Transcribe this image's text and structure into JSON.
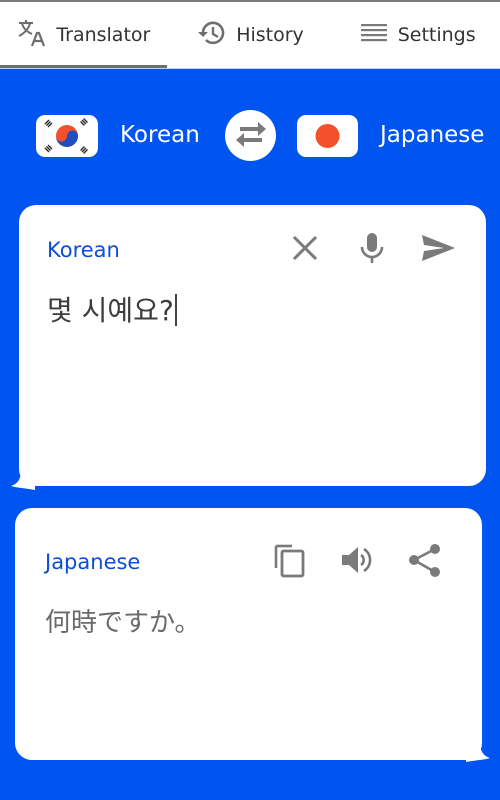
{
  "tabs": [
    {
      "label": "Translator",
      "icon": "translate-icon",
      "active": true
    },
    {
      "label": "History",
      "icon": "history-icon",
      "active": false
    },
    {
      "label": "Settings",
      "icon": "menu-icon",
      "active": false
    }
  ],
  "language_bar": {
    "source_language": "Korean",
    "source_flag": "south-korea-flag",
    "target_language": "Japanese",
    "target_flag": "japan-flag",
    "swap_icon": "swap-icon"
  },
  "source_card": {
    "language": "Korean",
    "text": "몇 시예요?",
    "actions": [
      "clear-icon",
      "microphone-icon",
      "send-icon"
    ]
  },
  "target_card": {
    "language": "Japanese",
    "text": "何時ですか。",
    "actions": [
      "copy-icon",
      "speaker-icon",
      "share-icon"
    ]
  },
  "colors": {
    "background": "#0055f0",
    "accent_text": "#0a4fd6",
    "icon_gray": "#7a7a7a",
    "flag_red": "#f4502c",
    "flag_blue": "#1f4fbf"
  }
}
